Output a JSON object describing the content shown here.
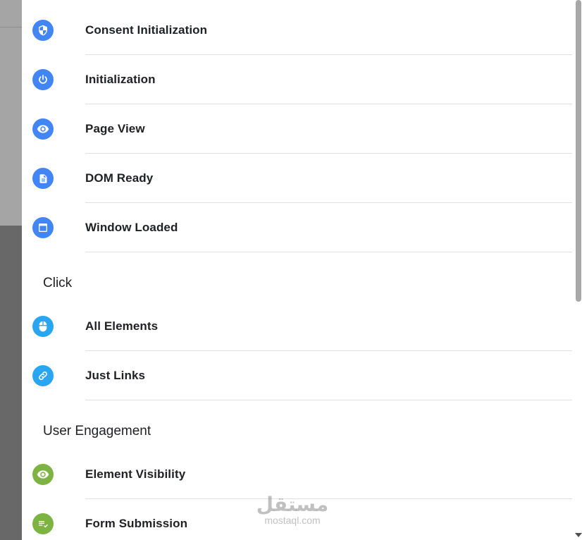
{
  "page_load_items": [
    {
      "label": "Consent Initialization",
      "icon": "shield-icon",
      "color": "#4285f4"
    },
    {
      "label": "Initialization",
      "icon": "power-icon",
      "color": "#4285f4"
    },
    {
      "label": "Page View",
      "icon": "eye-icon",
      "color": "#4285f4"
    },
    {
      "label": "DOM Ready",
      "icon": "document-icon",
      "color": "#4285f4"
    },
    {
      "label": "Window Loaded",
      "icon": "window-icon",
      "color": "#4285f4"
    }
  ],
  "click_section": {
    "title": "Click",
    "items": [
      {
        "label": "All Elements",
        "icon": "mouse-icon",
        "color": "#2aa5f2"
      },
      {
        "label": "Just Links",
        "icon": "link-icon",
        "color": "#2aa5f2"
      }
    ]
  },
  "engagement_section": {
    "title": "User Engagement",
    "items": [
      {
        "label": "Element Visibility",
        "icon": "eye-icon",
        "color": "#7cb342"
      },
      {
        "label": "Form Submission",
        "icon": "form-check-icon",
        "color": "#7cb342"
      }
    ]
  },
  "watermark": {
    "logo": "مستقل",
    "url": "mostaql.com"
  }
}
